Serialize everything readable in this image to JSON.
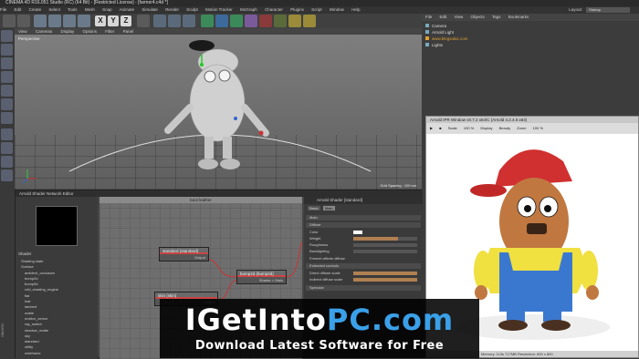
{
  "window": {
    "title": "CINEMA 4D R16.051 Studio (RC) (64 Bit) - [Restricted License] - [farmer4.c4d *]",
    "layout_label": "Layout:",
    "layout_value": "Startup"
  },
  "menubar": [
    "File",
    "Edit",
    "Create",
    "Select",
    "Tools",
    "Mesh",
    "Snap",
    "Animate",
    "Simulate",
    "Render",
    "Sculpt",
    "Motion Tracker",
    "MoGraph",
    "Character",
    "Plugins",
    "Script",
    "Window",
    "Help"
  ],
  "toolbar": {
    "axis_labels": [
      "X",
      "Y",
      "Z"
    ]
  },
  "viewport": {
    "menu": [
      "View",
      "Cameras",
      "Display",
      "Options",
      "Filter",
      "Panel"
    ],
    "label": "Perspective",
    "grid_spacing": "Grid Spacing : 100 cm"
  },
  "object_manager": {
    "tabs": [
      "File",
      "Edit",
      "View",
      "Objects",
      "Tags",
      "Bookmarks"
    ],
    "objects": [
      "Camera",
      "Arnold Light",
      "www.blegsolaz.com",
      "Lights"
    ]
  },
  "node_editor": {
    "title": "Arnold Shader Network Editor",
    "graph_title": "boot leather",
    "shader_label": "Shader",
    "shader_list": [
      "Shading state",
      "Surface",
      "ambient_occlusion",
      "bump2d",
      "bump3d",
      "c4d_shading_engine",
      "flat",
      "hair",
      "lambert",
      "matte",
      "motion_vector",
      "ray_switch",
      "shadow_matte",
      "sky",
      "standard",
      "utility",
      "wireframe"
    ],
    "nodes": [
      {
        "title": "standard (standard)",
        "port": "Output"
      },
      {
        "title": "bump2d (bump2d)",
        "port": "Output"
      },
      {
        "title": "bump2d (bump2d)",
        "port": "Shader < Main"
      },
      {
        "title": "skin (skin)",
        "port": "Output"
      }
    ]
  },
  "attributes": {
    "header": "Arnold Shader [standard]",
    "tabs": [
      "Basic",
      "Main"
    ],
    "section": "Main",
    "subsection": "Diffuse",
    "rows": [
      {
        "label": "Color",
        "value": ""
      },
      {
        "label": "Weight",
        "value": "0.7"
      },
      {
        "label": "Roughness",
        "value": "0"
      },
      {
        "label": "Backlighting",
        "value": "0"
      }
    ],
    "fresnel": "Fresnel affects diffuse",
    "extended": "Extended controls",
    "direct": "Direct diffuse scale",
    "indirect": "Indirect diffuse scale",
    "specular": "Specular",
    "slider_fill": [
      0,
      0.7,
      0,
      0,
      0,
      1,
      1
    ]
  },
  "ipr": {
    "title": "Arnold IPR Window v0.7.2 x64/C (Arnold 4.2.4.0.x64)",
    "toolbar": [
      "Scale",
      "100 %",
      "Display",
      "Beauty",
      "Zoom",
      "100 %"
    ],
    "status": "Memory: 113s 717MB Resolution: 600 x 800"
  },
  "watermark": {
    "brand": "IGetIntoPC.com",
    "tagline": "Download Latest Software for Free"
  },
  "sidebar_label": "MAXON",
  "colors": {
    "accent_red": "#d03030",
    "logo_blue": "#3aa0e8",
    "orange_highlight": "#e0a030"
  }
}
